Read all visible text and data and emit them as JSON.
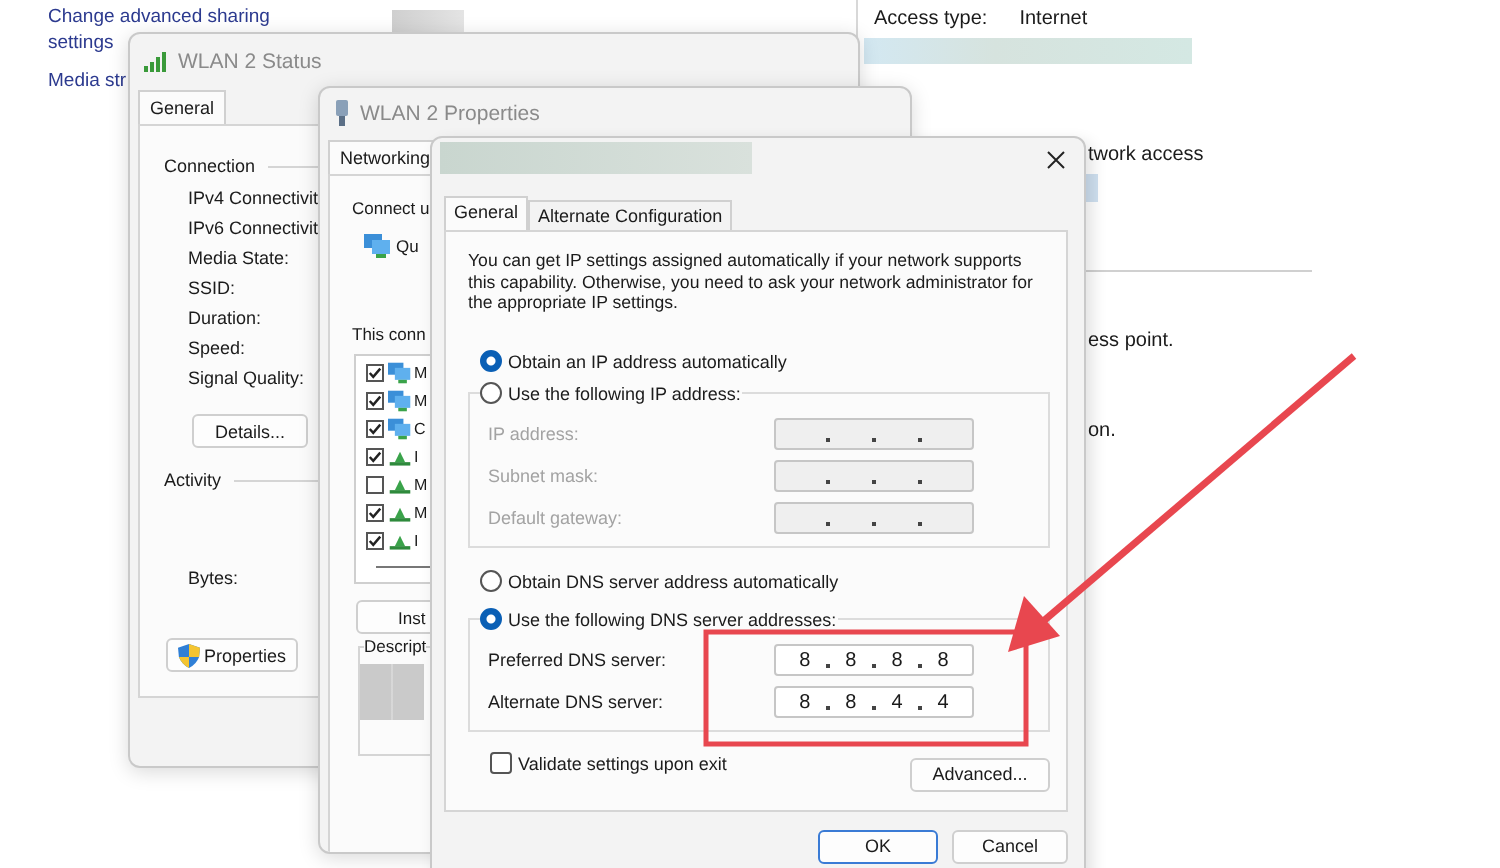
{
  "background": {
    "links": [
      {
        "lines": [
          "Change advanced sharing",
          "settings"
        ]
      },
      {
        "lines": [
          "Media str"
        ]
      }
    ],
    "access_type": {
      "label": "Access type:",
      "value": "Internet"
    },
    "fragments": [
      "twork access",
      "ess point.",
      "on."
    ]
  },
  "status_window": {
    "title": "WLAN 2 Status",
    "tab": {
      "label": "General",
      "selected": true
    },
    "connection_heading": "Connection",
    "fields": [
      "IPv4 Connectivit",
      "IPv6 Connectivit",
      "Media State:",
      "SSID:",
      "Duration:",
      "Speed:",
      "Signal Quality:"
    ],
    "details_button": "Details...",
    "activity_heading": "Activity",
    "bytes_label": "Bytes:",
    "properties_button": "Properties"
  },
  "properties_window": {
    "title": "WLAN 2 Properties",
    "tab": {
      "label": "Networking",
      "selected": true
    },
    "connect_using": "Connect u",
    "adapter": "Qu",
    "components_label": "This conn",
    "components": [
      {
        "kind": "client",
        "label": "M",
        "checked": true
      },
      {
        "kind": "client",
        "label": "M",
        "checked": true
      },
      {
        "kind": "client",
        "label": "C",
        "checked": true
      },
      {
        "kind": "protocol",
        "label": "I",
        "checked": true
      },
      {
        "kind": "protocol",
        "label": "M",
        "checked": false
      },
      {
        "kind": "protocol",
        "label": "M",
        "checked": true
      },
      {
        "kind": "protocol",
        "label": "I",
        "checked": true
      }
    ],
    "install_button": "Inst",
    "description_heading": "Descript"
  },
  "ipv4_dialog": {
    "tabs": [
      {
        "label": "General",
        "selected": true
      },
      {
        "label": "Alternate Configuration",
        "selected": false
      }
    ],
    "intro": "You can get IP settings assigned automatically if your network supports this capability. Otherwise, you need to ask your network administrator for the appropriate IP settings.",
    "ip_mode": [
      {
        "label": "Obtain an IP address automatically",
        "selected": true
      },
      {
        "label": "Use the following IP address:",
        "selected": false
      }
    ],
    "ip_fields": [
      {
        "label": "IP address:",
        "disabled": true
      },
      {
        "label": "Subnet mask:",
        "disabled": true
      },
      {
        "label": "Default gateway:",
        "disabled": true
      }
    ],
    "dns_mode": [
      {
        "label": "Obtain DNS server address automatically",
        "selected": false
      },
      {
        "label": "Use the following DNS server addresses:",
        "selected": true
      }
    ],
    "dns_fields": [
      {
        "label": "Preferred DNS server:",
        "disabled": false,
        "octets": [
          "8",
          "8",
          "8",
          "8"
        ]
      },
      {
        "label": "Alternate DNS server:",
        "disabled": false,
        "octets": [
          "8",
          "8",
          "4",
          "4"
        ]
      }
    ],
    "validate": {
      "label": "Validate settings upon exit",
      "checked": false
    },
    "advanced_button": "Advanced...",
    "ok_button": "OK",
    "cancel_button": "Cancel"
  }
}
